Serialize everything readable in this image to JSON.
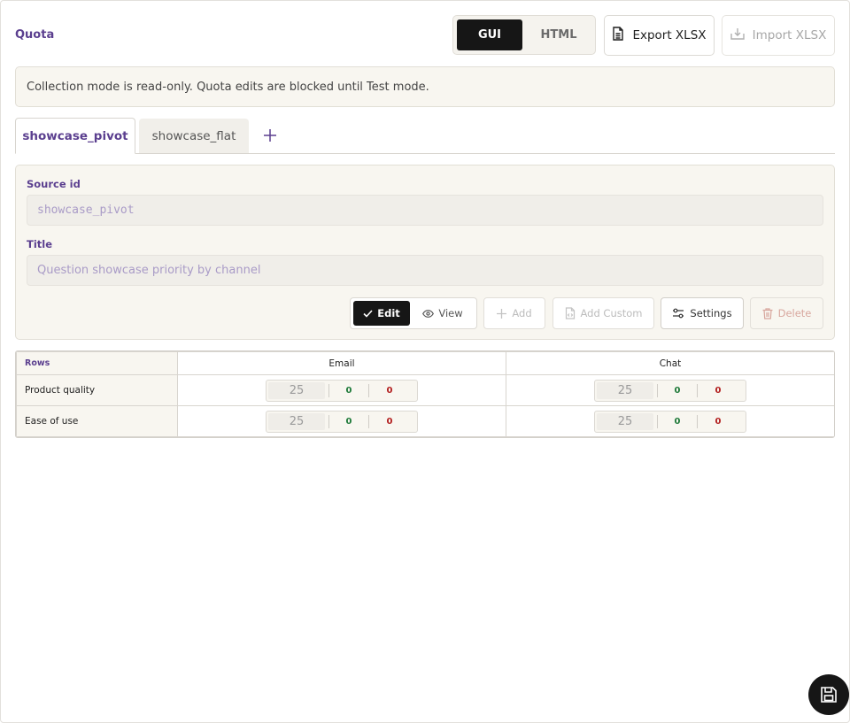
{
  "header": {
    "title": "Quota",
    "modes": [
      "GUI",
      "HTML"
    ],
    "active_mode": "GUI",
    "export_label": "Export XLSX",
    "import_label": "Import XLSX"
  },
  "banner": {
    "message": "Collection mode is read-only. Quota edits are blocked until Test mode."
  },
  "tabs": {
    "items": [
      {
        "label": "showcase_pivot",
        "active": true
      },
      {
        "label": "showcase_flat",
        "active": false
      }
    ],
    "add_icon": "plus-icon"
  },
  "form": {
    "source_id_label": "Source id",
    "source_id_value": "showcase_pivot",
    "title_label": "Title",
    "title_value": "Question showcase priority by channel"
  },
  "toolbar": {
    "edit_label": "Edit",
    "view_label": "View",
    "add_label": "Add",
    "add_custom_label": "Add Custom",
    "settings_label": "Settings",
    "delete_label": "Delete"
  },
  "grid": {
    "rows_header": "Rows",
    "columns": [
      "Email",
      "Chat"
    ],
    "rows": [
      {
        "label": "Product quality",
        "cells": [
          {
            "target": "25",
            "green": "0",
            "red": "0"
          },
          {
            "target": "25",
            "green": "0",
            "red": "0"
          }
        ]
      },
      {
        "label": "Ease of use",
        "cells": [
          {
            "target": "25",
            "green": "0",
            "red": "0"
          },
          {
            "target": "25",
            "green": "0",
            "red": "0"
          }
        ]
      }
    ]
  },
  "colors": {
    "accent": "#5b3f8f",
    "dark": "#161616",
    "panel_bg": "#f8f6f0",
    "green": "#1f7a3a",
    "red": "#b21e1e"
  },
  "icons": {
    "export": "file-spreadsheet-icon",
    "import": "import-icon",
    "edit": "check-icon",
    "view": "eye-icon",
    "add": "plus-icon",
    "add_custom": "file-code-icon",
    "settings": "sliders-icon",
    "delete": "trash-icon",
    "save": "save-icon"
  }
}
